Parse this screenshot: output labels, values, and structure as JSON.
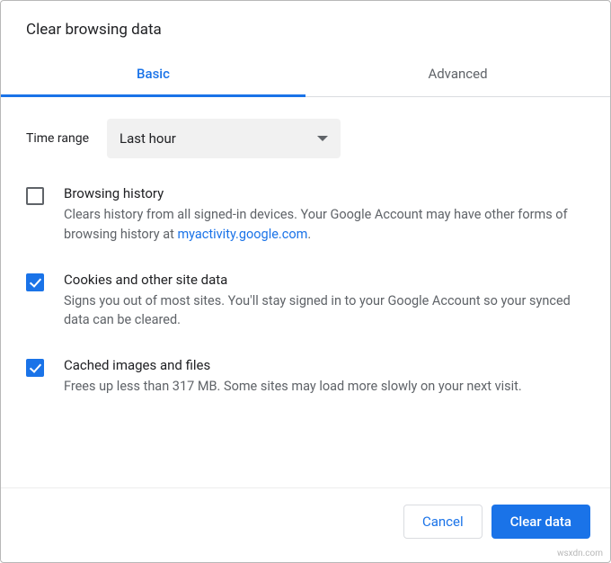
{
  "title": "Clear browsing data",
  "tabs": {
    "basic": "Basic",
    "advanced": "Advanced"
  },
  "timerange": {
    "label": "Time range",
    "value": "Last hour"
  },
  "options": {
    "history": {
      "checked": false,
      "title": "Browsing history",
      "desc_pre": "Clears history from all signed-in devices. Your Google Account may have other forms of browsing history at ",
      "desc_link": "myactivity.google.com",
      "desc_post": "."
    },
    "cookies": {
      "checked": true,
      "title": "Cookies and other site data",
      "desc": "Signs you out of most sites. You'll stay signed in to your Google Account so your synced data can be cleared."
    },
    "cache": {
      "checked": true,
      "title": "Cached images and files",
      "desc": "Frees up less than 317 MB. Some sites may load more slowly on your next visit."
    }
  },
  "buttons": {
    "cancel": "Cancel",
    "clear": "Clear data"
  },
  "watermark": "wsxdn.com"
}
